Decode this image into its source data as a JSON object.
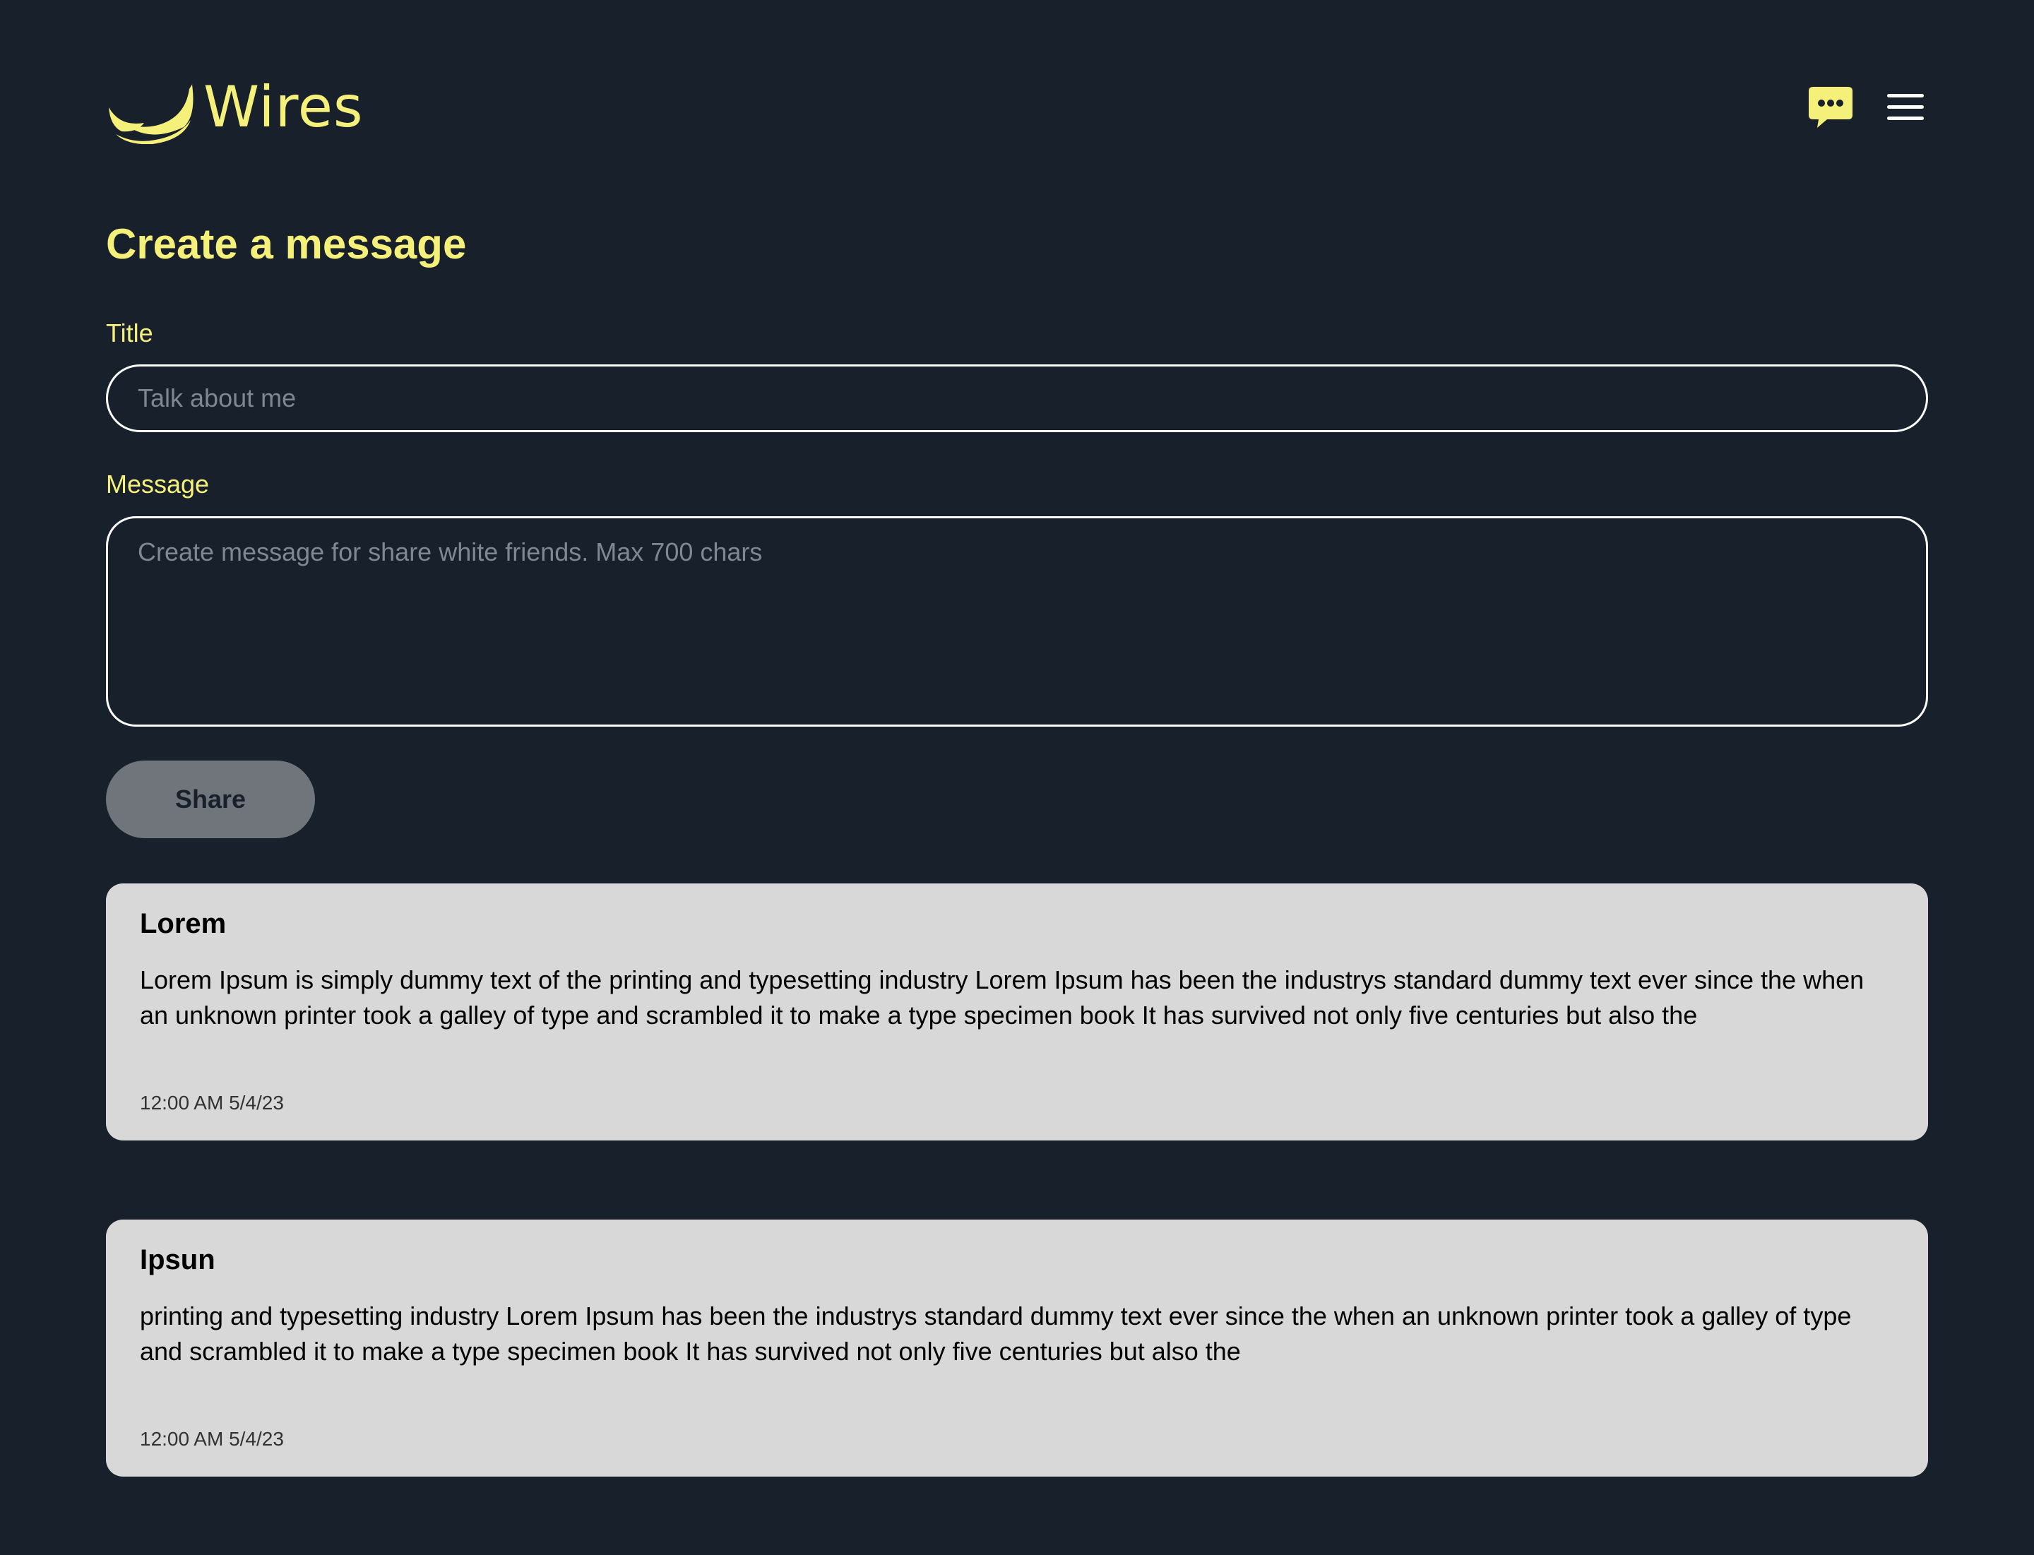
{
  "app": {
    "name": "Wires",
    "brand_color": "#f5f07a",
    "background_color": "#17202b"
  },
  "header": {
    "logo_text": "Wires",
    "logo_icon": "smile-arc-icon",
    "actions": [
      {
        "icon": "chat-bubble-icon"
      },
      {
        "icon": "hamburger-menu-icon"
      }
    ]
  },
  "form": {
    "heading": "Create a message",
    "title_label": "Title",
    "title_placeholder": "Talk about me",
    "title_value": "",
    "message_label": "Message",
    "message_placeholder": "Create message for share white friends. Max 700 chars",
    "message_value": "",
    "share_label": "Share"
  },
  "messages": [
    {
      "title": "Lorem",
      "body": "Lorem Ipsum is simply dummy text of the printing and typesetting industry Lorem Ipsum has been the industrys standard dummy text ever since the when an unknown printer took a galley of type and scrambled it to make a type specimen book It has survived not only five centuries but also the",
      "timestamp": "12:00 AM 5/4/23"
    },
    {
      "title": "Ipsun",
      "body": "printing and typesetting industry Lorem Ipsum has been the industrys standard dummy text ever since the when an unknown printer took a galley of type and scrambled it to make a type specimen book It has survived not only five centuries but also the",
      "timestamp": "12:00 AM 5/4/23"
    }
  ]
}
